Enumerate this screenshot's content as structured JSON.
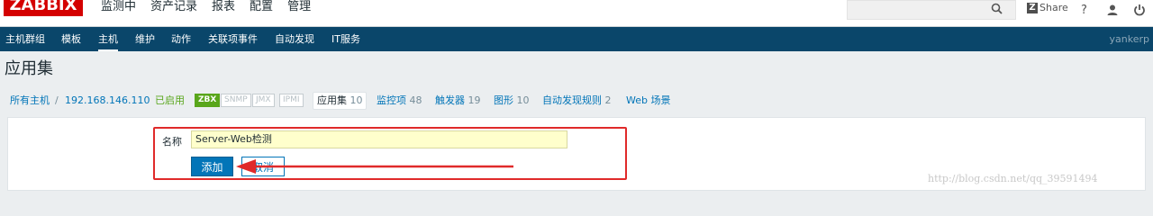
{
  "logo": "ZABBIX",
  "top_menu": [
    "监测中",
    "资产记录",
    "报表",
    "配置",
    "管理"
  ],
  "top_right": {
    "share_label": "Share",
    "help_label": "?"
  },
  "sub_menu": [
    "主机群组",
    "模板",
    "主机",
    "维护",
    "动作",
    "关联项事件",
    "自动发现",
    "IT服务"
  ],
  "user_name": "yankerp",
  "page_title": "应用集",
  "host_nav": {
    "all_hosts": "所有主机",
    "separator": "/",
    "host": "192.168.146.110",
    "status": "已启用",
    "tags": [
      "ZBX",
      "SNMP",
      "JMX",
      "IPMI"
    ],
    "tabs": [
      {
        "label": "应用集",
        "count": "10"
      },
      {
        "label": "监控项",
        "count": "48"
      },
      {
        "label": "触发器",
        "count": "19"
      },
      {
        "label": "图形",
        "count": "10"
      },
      {
        "label": "自动发现规则",
        "count": "2"
      },
      {
        "label": "Web 场景",
        "count": ""
      }
    ]
  },
  "form": {
    "name_label": "名称",
    "name_value": "Server-Web检测",
    "add_label": "添加",
    "cancel_label": "取消"
  },
  "watermark": "http://blog.csdn.net/qq_39591494",
  "colors": {
    "nav_bg": "#0a466a",
    "link": "#0275b8",
    "enabled": "#59a61b",
    "annotation": "#e02a2a"
  }
}
